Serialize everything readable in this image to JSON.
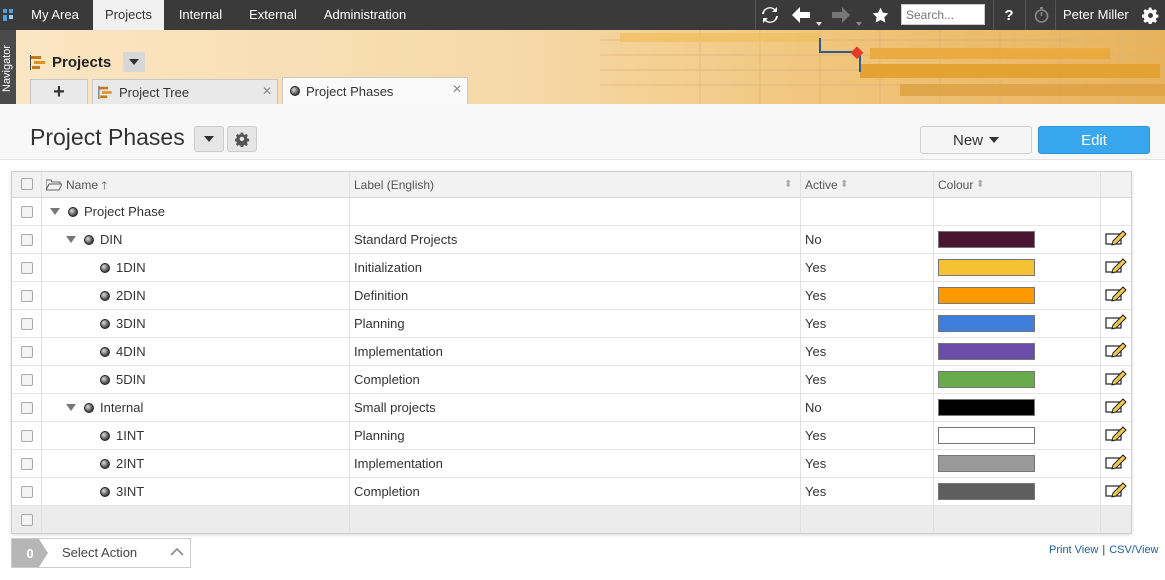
{
  "topbar": {
    "nav": [
      "My Area",
      "Projects",
      "Internal",
      "External",
      "Administration"
    ],
    "search_placeholder": "Search...",
    "user": "Peter Miller",
    "help": "?"
  },
  "navigator": "Navigator",
  "header": {
    "module_title": "Projects",
    "tabs": [
      {
        "label": "+"
      },
      {
        "label": "Project Tree"
      },
      {
        "label": "Project Phases"
      }
    ]
  },
  "page": {
    "title": "Project Phases",
    "new_label": "New",
    "edit_label": "Edit"
  },
  "grid": {
    "columns": [
      "Name",
      "Label (English)",
      "Active",
      "Colour"
    ],
    "rows": [
      {
        "name": "Project Phase",
        "label": "",
        "active": "",
        "colour": "",
        "level": 0,
        "expandable": true
      },
      {
        "name": "DIN",
        "label": "Standard Projects",
        "active": "No",
        "colour": "#4a1530",
        "level": 1,
        "expandable": true
      },
      {
        "name": "1DIN",
        "label": "Initialization",
        "active": "Yes",
        "colour": "#f4c233",
        "level": 2,
        "expandable": false
      },
      {
        "name": "2DIN",
        "label": "Definition",
        "active": "Yes",
        "colour": "#ff9900",
        "level": 2,
        "expandable": false
      },
      {
        "name": "3DIN",
        "label": "Planning",
        "active": "Yes",
        "colour": "#3f7ddb",
        "level": 2,
        "expandable": false
      },
      {
        "name": "4DIN",
        "label": "Implementation",
        "active": "Yes",
        "colour": "#6b4ca8",
        "level": 2,
        "expandable": false
      },
      {
        "name": "5DIN",
        "label": "Completion",
        "active": "Yes",
        "colour": "#67ab4c",
        "level": 2,
        "expandable": false
      },
      {
        "name": "Internal",
        "label": "Small projects",
        "active": "No",
        "colour": "#000000",
        "level": 1,
        "expandable": true
      },
      {
        "name": "1INT",
        "label": "Planning",
        "active": "Yes",
        "colour": "#ffffff",
        "level": 2,
        "expandable": false
      },
      {
        "name": "2INT",
        "label": "Implementation",
        "active": "Yes",
        "colour": "#999999",
        "level": 2,
        "expandable": false
      },
      {
        "name": "3INT",
        "label": "Completion",
        "active": "Yes",
        "colour": "#5e5e5e",
        "level": 2,
        "expandable": false
      }
    ]
  },
  "footer": {
    "selected_count": "0",
    "action_label": "Select Action",
    "print_view": "Print View",
    "csv_view": "CSV/View"
  }
}
